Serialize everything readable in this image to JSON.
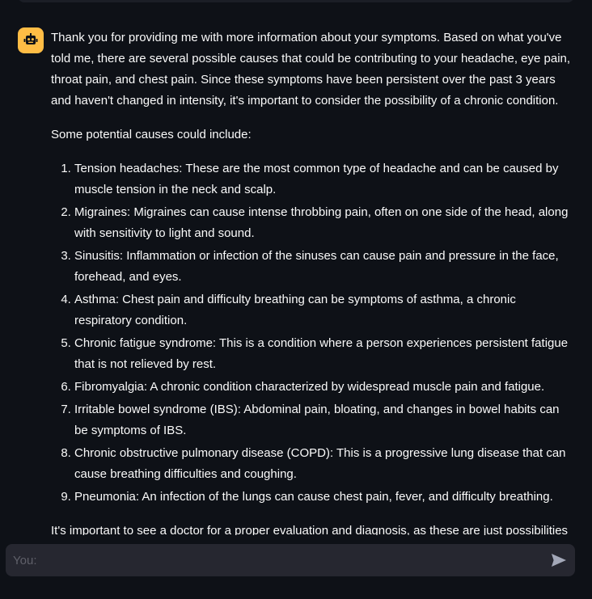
{
  "assistant_message": {
    "intro": "Thank you for providing me with more information about your symptoms. Based on what you've told me, there are several possible causes that could be contributing to your headache, eye pain, throat pain, and chest pain. Since these symptoms have been persistent over the past 3 years and haven't changed in intensity, it's important to consider the possibility of a chronic condition.",
    "list_heading": "Some potential causes could include:",
    "causes": [
      "Tension headaches: These are the most common type of headache and can be caused by muscle tension in the neck and scalp.",
      "Migraines: Migraines can cause intense throbbing pain, often on one side of the head, along with sensitivity to light and sound.",
      "Sinusitis: Inflammation or infection of the sinuses can cause pain and pressure in the face, forehead, and eyes.",
      "Asthma: Chest pain and difficulty breathing can be symptoms of asthma, a chronic respiratory condition.",
      "Chronic fatigue syndrome: This is a condition where a person experiences persistent fatigue that is not relieved by rest.",
      "Fibromyalgia: A chronic condition characterized by widespread muscle pain and fatigue.",
      "Irritable bowel syndrome (IBS): Abdominal pain, bloating, and changes in bowel habits can be symptoms of IBS.",
      "Chronic obstructive pulmonary disease (COPD): This is a progressive lung disease that can cause breathing difficulties and coughing.",
      "Pneumonia: An infection of the lungs can cause chest pain, fever, and difficulty breathing."
    ],
    "closing": "It's important to see a doctor for a proper evaluation and diagnosis, as these are just possibilities"
  },
  "chat_input": {
    "placeholder": "You:",
    "value": ""
  },
  "icons": {
    "avatar": "robot-icon",
    "send": "send-arrow-icon"
  },
  "colors": {
    "background": "#0e1117",
    "avatar_bg": "#ffbd45",
    "input_bg": "#262730",
    "text": "#fafafa"
  }
}
